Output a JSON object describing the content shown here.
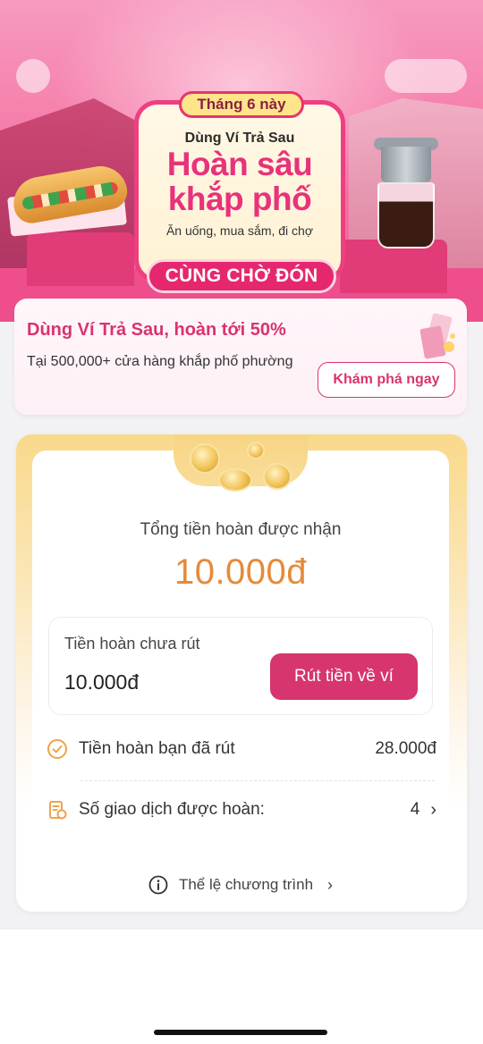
{
  "banner": {
    "tag": "Tháng 6 này",
    "line1": "Dùng Ví Trả Sau",
    "headline_1": "Hoàn sâu",
    "headline_2": "khắp phố",
    "subline": "Ăn uống, mua sắm, đi chợ",
    "cta": "CÙNG CHỜ ĐÓN"
  },
  "promo": {
    "title": "Dùng Ví Trả Sau, hoàn tới 50%",
    "description": "Tại 500,000+ cửa hàng khắp phố phường",
    "button": "Khám phá ngay"
  },
  "cashback": {
    "total_label": "Tổng tiền hoàn được nhận",
    "total_amount": "10.000đ",
    "pending_label": "Tiền hoàn chưa rút",
    "pending_amount": "10.000đ",
    "withdraw_button": "Rút tiền về ví",
    "withdrawn_label": "Tiền hoàn bạn đã rút",
    "withdrawn_amount": "28.000đ",
    "transactions_label": "Số giao dịch được hoàn:",
    "transactions_count": "4",
    "rules_link": "Thể lệ chương trình"
  },
  "colors": {
    "brand_pink": "#d6356f",
    "amount_orange": "#e68a3a",
    "banner_pink": "#f57aa8",
    "check_icon": "#f0a24a"
  }
}
